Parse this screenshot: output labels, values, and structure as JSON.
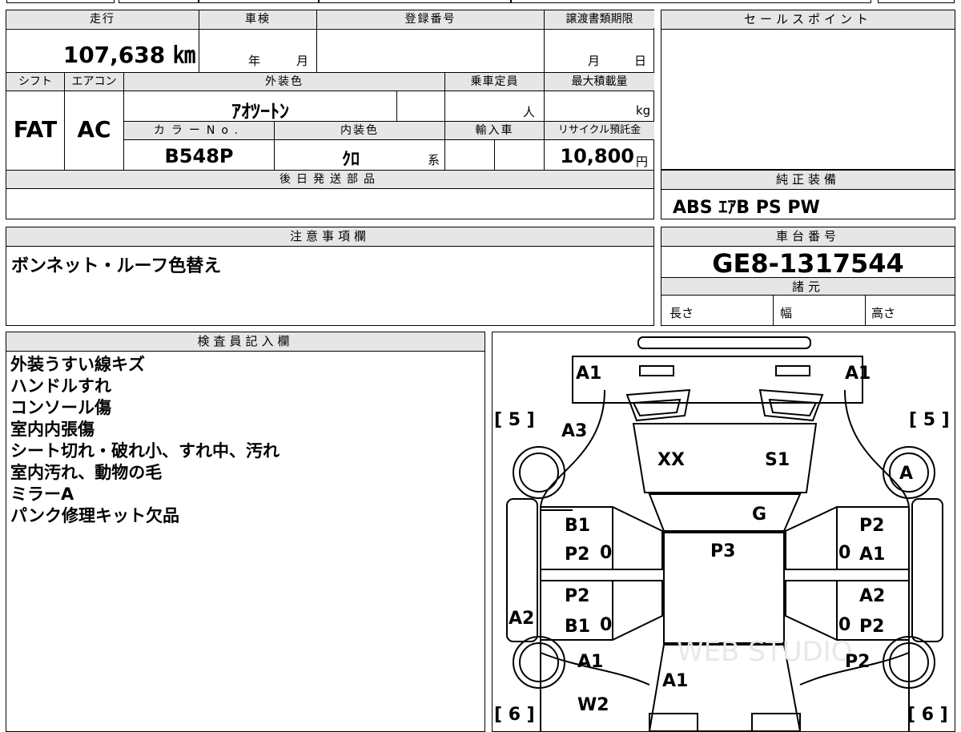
{
  "sheet": {
    "mileage_label": "走行",
    "mileage_value": "107,638 ㎞",
    "inspection_label": "車検",
    "inspection_year": "年",
    "inspection_month": "月",
    "registration_label": "登録番号",
    "transfer_label": "譲渡書類期限",
    "transfer_month": "月",
    "transfer_day": "日",
    "shift_label": "シフト",
    "shift_value": "FAT",
    "ac_label": "エアコン",
    "ac_value": "AC",
    "exterior_label": "外装色",
    "exterior_value": "ｱｵﾂｰﾄﾝ",
    "capacity_label": "乗車定員",
    "capacity_unit": "人",
    "load_label": "最大積載量",
    "load_unit": "kg",
    "color_no_label": "カラーNo.",
    "color_no_value": "B548P",
    "interior_label": "内装色",
    "interior_value": "ｸﾛ",
    "interior_suffix": "系",
    "import_label": "輸入車",
    "recycle_label": "リサイクル預託金",
    "recycle_value": "10,800",
    "recycle_unit": "円",
    "later_parts_label": "後日発送部品",
    "later_parts_value": ""
  },
  "sales_point": {
    "label": "セールスポイント",
    "value": ""
  },
  "standard_equipment": {
    "label": "純正装備",
    "value": "ABS ｴｱB PS PW"
  },
  "notice": {
    "label": "注意事項欄",
    "value": "ボンネット・ルーフ色替え"
  },
  "chassis": {
    "label": "車台番号",
    "value": "GE8-1317544",
    "specs_label": "諸元",
    "length_label": "長さ",
    "width_label": "幅",
    "height_label": "高さ"
  },
  "inspector": {
    "label": "検査員記入欄",
    "lines": [
      "外装うすい線キズ",
      "ハンドルすれ",
      "コンソール傷",
      "室内内張傷",
      "シート切れ・破れ小、すれ中、汚れ",
      "室内汚れ、動物の毛",
      "ミラーA",
      "パンク修理キット欠品"
    ]
  },
  "diagram": {
    "marks": {
      "front_left": "A1",
      "front_right": "A1",
      "bracket_top_left": "[ 5 ]",
      "bracket_top_right": "[ 5 ]",
      "fender_front_left": "A3",
      "hood_left": "XX",
      "hood_right": "S1",
      "wheel_front_right": "A",
      "windshield": "G",
      "door_fl_top": "B1",
      "door_fl_bottom": "P2",
      "roof": "P3",
      "door_fr_top": "P2",
      "door_fr_bottom": "A1",
      "door_rl_top": "P2",
      "door_rl_bottom": "B1",
      "side_left": "A2",
      "door_rr_top": "A2",
      "door_rr_bottom": "P2",
      "quarter_rl": "A1",
      "trunk": "A1",
      "quarter_rr": "P2",
      "rear_glass_left": "W2",
      "bracket_bottom_left": "[ 6 ]",
      "bracket_bottom_right": "[ 6 ]",
      "handle_fl": "0",
      "handle_fr": "0",
      "handle_rl": "0",
      "handle_rr": "0"
    },
    "watermark": "WEB STUDIO"
  }
}
